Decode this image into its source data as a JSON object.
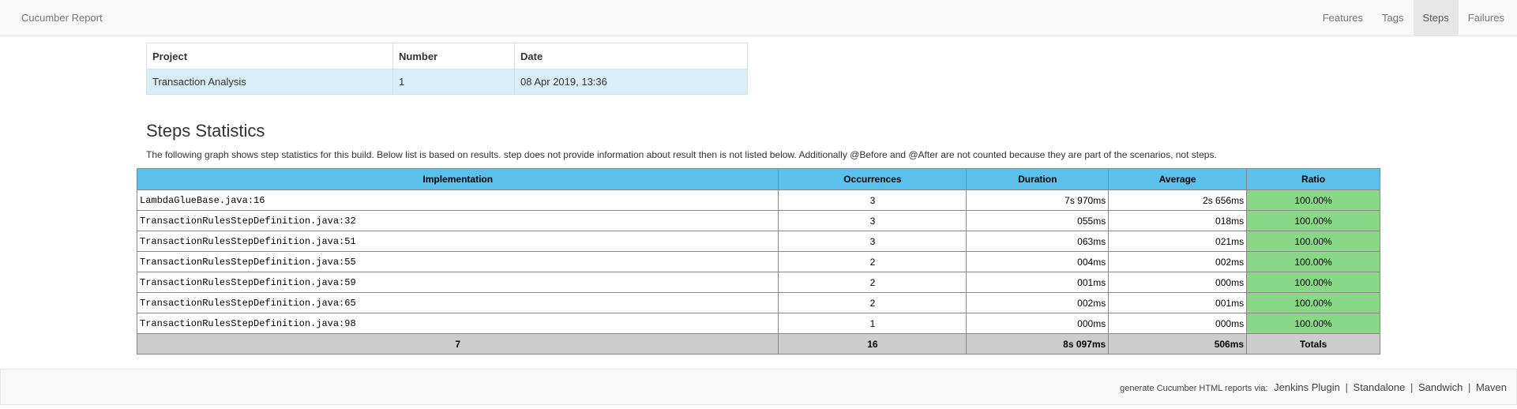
{
  "navbar": {
    "brand": "Cucumber Report",
    "items": [
      {
        "label": "Features",
        "active": false
      },
      {
        "label": "Tags",
        "active": false
      },
      {
        "label": "Steps",
        "active": true
      },
      {
        "label": "Failures",
        "active": false
      }
    ]
  },
  "build_info": {
    "headers": [
      "Project",
      "Number",
      "Date"
    ],
    "row": [
      "Transaction Analysis",
      "1",
      "08 Apr 2019, 13:36"
    ]
  },
  "stats": {
    "title": "Steps Statistics",
    "description": "The following graph shows step statistics for this build. Below list is based on results. step does not provide information about result then is not listed below. Additionally @Before and @After are not counted because they are part of the scenarios, not steps.",
    "headers": [
      "Implementation",
      "Occurrences",
      "Duration",
      "Average",
      "Ratio"
    ],
    "rows": [
      {
        "implementation": "LambdaGlueBase.java:16",
        "occurrences": "3",
        "duration": "7s 970ms",
        "average": "2s 656ms",
        "ratio": "100.00%"
      },
      {
        "implementation": "TransactionRulesStepDefinition.java:32",
        "occurrences": "3",
        "duration": "055ms",
        "average": "018ms",
        "ratio": "100.00%"
      },
      {
        "implementation": "TransactionRulesStepDefinition.java:51",
        "occurrences": "3",
        "duration": "063ms",
        "average": "021ms",
        "ratio": "100.00%"
      },
      {
        "implementation": "TransactionRulesStepDefinition.java:55",
        "occurrences": "2",
        "duration": "004ms",
        "average": "002ms",
        "ratio": "100.00%"
      },
      {
        "implementation": "TransactionRulesStepDefinition.java:59",
        "occurrences": "2",
        "duration": "001ms",
        "average": "000ms",
        "ratio": "100.00%"
      },
      {
        "implementation": "TransactionRulesStepDefinition.java:65",
        "occurrences": "2",
        "duration": "002ms",
        "average": "001ms",
        "ratio": "100.00%"
      },
      {
        "implementation": "TransactionRulesStepDefinition.java:98",
        "occurrences": "1",
        "duration": "000ms",
        "average": "000ms",
        "ratio": "100.00%"
      }
    ],
    "totals": {
      "implementation": "7",
      "occurrences": "16",
      "duration": "8s 097ms",
      "average": "506ms",
      "ratio": "Totals"
    }
  },
  "footer": {
    "prefix": "generate Cucumber HTML reports via:",
    "links": [
      "Jenkins Plugin",
      "Standalone",
      "Sandwich",
      "Maven"
    ],
    "separator": "|"
  },
  "colors": {
    "header_blue": "#5bc0eb",
    "ratio_green": "#88d888",
    "totals_gray": "#cccccc",
    "info_row": "#d9edf7"
  }
}
